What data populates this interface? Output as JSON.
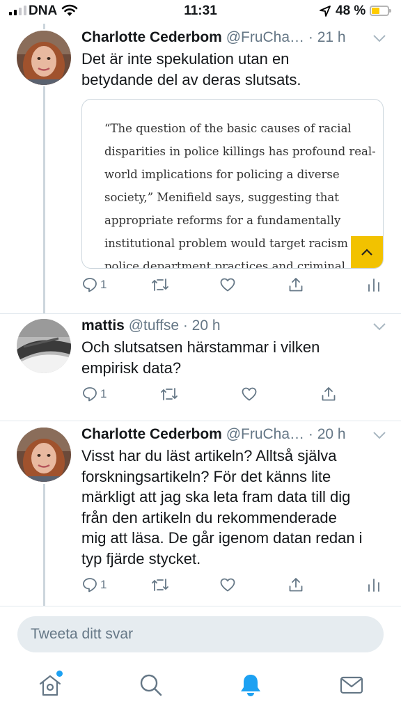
{
  "status_bar": {
    "carrier": "DNA",
    "time": "11:31",
    "battery_percent": "48 %",
    "battery_level": 0.48
  },
  "tweets": [
    {
      "name": "Charlotte Cederbom",
      "handle": "@FruCha…",
      "time": "· 21 h",
      "text_lines": [
        "Det är inte spekulation utan en",
        "betydande del av deras slutsats."
      ],
      "card": {
        "lines": [
          "“The question of the basic causes of racial",
          "disparities in police killings has profound real-",
          "world implications for policing a diverse",
          "society,” Menifield says, suggesting that",
          "appropriate reforms for a fundamentally",
          "institutional problem would target racism in",
          "police department practices and criminal"
        ]
      },
      "reply_count": "1"
    },
    {
      "name": "mattis",
      "handle": "@tuffse",
      "time": "· 20 h",
      "text_lines": [
        "Och slutsatsen härstammar i vilken",
        "empirisk data?"
      ],
      "reply_count": "1"
    },
    {
      "name": "Charlotte Cederbom",
      "handle": "@FruCha…",
      "time": "· 20 h",
      "text_lines": [
        "Visst har du läst artikeln? Alltså själva",
        "forskningsartikeln? För det känns lite",
        "märkligt att jag ska leta fram data till dig",
        "från den artikeln du rekommenderade",
        "mig att läsa. De går igenom datan redan i",
        "typ fjärde stycket."
      ],
      "reply_count": "1"
    }
  ],
  "reply_bar": {
    "placeholder": "Tweeta ditt svar"
  },
  "tab_bar": {
    "items": [
      "home-icon",
      "search-icon",
      "notifications-icon",
      "messages-icon"
    ],
    "active": "notifications-icon"
  },
  "colors": {
    "accent": "#1da1f2",
    "text_primary": "#14171a",
    "text_secondary": "#657786",
    "card_button": "#f2c200",
    "battery": "#ffcc00"
  }
}
